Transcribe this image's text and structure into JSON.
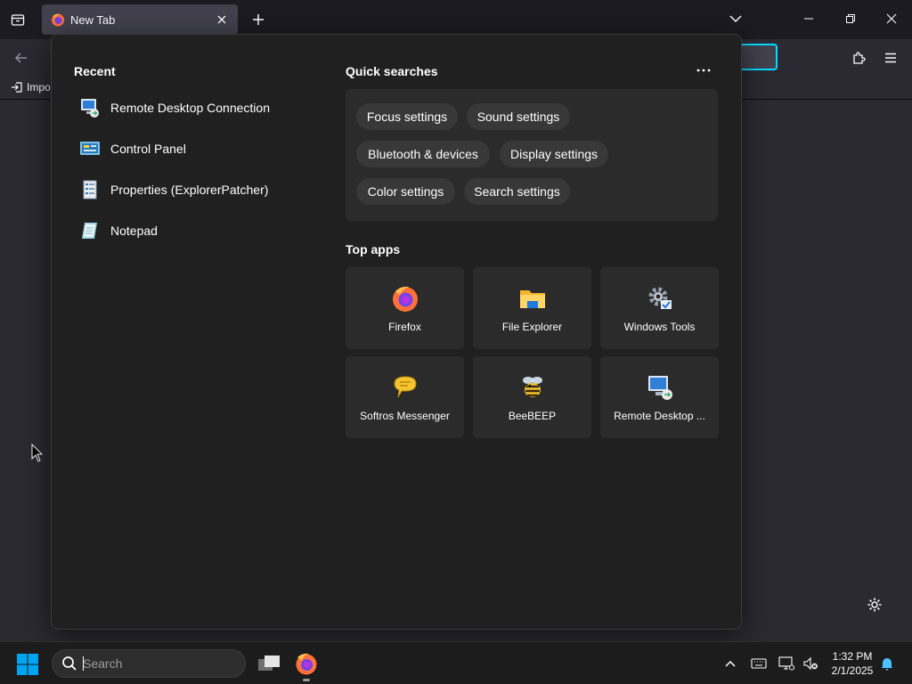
{
  "browser": {
    "tab_title": "New Tab",
    "bookmarks_item": "Impo"
  },
  "flyout": {
    "recent_title": "Recent",
    "recent": [
      {
        "label": "Remote Desktop Connection",
        "icon": "remote-desktop-icon"
      },
      {
        "label": "Control Panel",
        "icon": "control-panel-icon"
      },
      {
        "label": "Properties (ExplorerPatcher)",
        "icon": "properties-icon"
      },
      {
        "label": "Notepad",
        "icon": "notepad-icon"
      }
    ],
    "quick_title": "Quick searches",
    "quick_searches": [
      "Focus settings",
      "Sound settings",
      "Bluetooth & devices",
      "Display settings",
      "Color settings",
      "Search settings"
    ],
    "top_title": "Top apps",
    "top_apps": [
      {
        "label": "Firefox",
        "icon": "firefox-icon"
      },
      {
        "label": "File Explorer",
        "icon": "folder-icon"
      },
      {
        "label": "Windows Tools",
        "icon": "windows-tools-icon"
      },
      {
        "label": "Softros Messenger",
        "icon": "messenger-icon"
      },
      {
        "label": "BeeBEEP",
        "icon": "bee-icon"
      },
      {
        "label": "Remote Desktop ...",
        "icon": "remote-desktop-icon"
      }
    ]
  },
  "taskbar": {
    "search_placeholder": "Search",
    "time": "1:32 PM",
    "date": "2/1/2025"
  },
  "colors": {
    "accent": "#00ddff",
    "windows_blue": "#00a4ef"
  }
}
